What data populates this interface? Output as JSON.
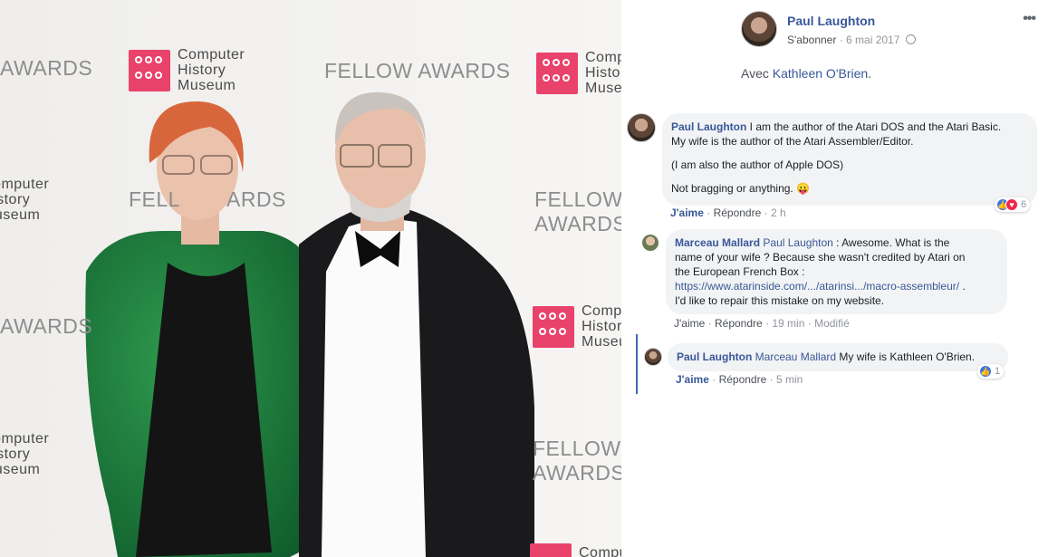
{
  "photo": {
    "logo_text": [
      "Computer",
      "History",
      "Museum"
    ],
    "banner": "FELLOW AWARDS",
    "banner_partial_left": "AWARDS",
    "banner_partial_mid": "FELL",
    "banner_partial_mid2": "ARDS",
    "banner_partial_right_text": "Comput"
  },
  "post": {
    "author": "Paul Laughton",
    "subscribe": "S'abonner",
    "separator": "·",
    "date": "6 mai 2017",
    "more": "•••",
    "with_label": "Avec",
    "with_name": "Kathleen O'Brien",
    "with_suffix": "."
  },
  "comments": [
    {
      "author": "Paul Laughton",
      "text1": "I am the author of the Atari DOS and the Atari Basic.",
      "text2": "My wife is the author of the Atari Assembler/Editor.",
      "text3": "(I am also the author of Apple DOS)",
      "text4": "Not bragging or anything. 😛",
      "like": "J'aime",
      "reply": "Répondre",
      "time": "2 h",
      "reaction_count": "6"
    },
    {
      "author": "Marceau Mallard",
      "mention": "Paul Laughton",
      "text1": " : Awesome. What is the",
      "text2": "name of your wife ? Because she wasn't credited by Atari on",
      "text3": "the European French Box :",
      "link": "https://www.atarinside.com/.../atarinsi.../macro-assembleur/",
      "link_suffix": " .",
      "text4": "I'd like to repair this mistake on my website.",
      "like": "J'aime",
      "reply": "Répondre",
      "time": "19 min",
      "edited": "Modifié"
    },
    {
      "author": "Paul Laughton",
      "mention": "Marceau Mallard",
      "text1": " My wife is Kathleen O'Brien.",
      "like": "J'aime",
      "reply": "Répondre",
      "time": "5 min",
      "reaction_count": "1"
    }
  ],
  "colors": {
    "link": "#385898",
    "bubble": "#f2f3f5",
    "thread_line": "#4267b2",
    "logo_pink": "#e9426b"
  }
}
